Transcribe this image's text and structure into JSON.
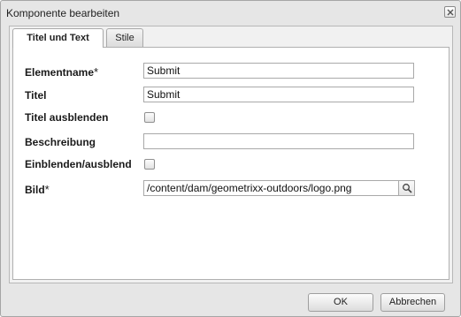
{
  "dialog": {
    "title": "Komponente bearbeiten"
  },
  "tabs": [
    {
      "label": "Titel und Text",
      "active": true
    },
    {
      "label": "Stile",
      "active": false
    }
  ],
  "form": {
    "element_name": {
      "label": "Elementname",
      "required_mark": "*",
      "value": "Submit"
    },
    "title": {
      "label": "Titel",
      "value": "Submit"
    },
    "hide_title": {
      "label": "Titel ausblenden",
      "checked": false
    },
    "description": {
      "label": "Beschreibung",
      "value": ""
    },
    "toggle": {
      "label": "Einblenden/ausblend",
      "checked": false
    },
    "image": {
      "label": "Bild",
      "required_mark": "*",
      "value": "/content/dam/geometrixx-outdoors/logo.png",
      "icon": "search-icon"
    }
  },
  "footer": {
    "ok_label": "OK",
    "cancel_label": "Abbrechen"
  }
}
